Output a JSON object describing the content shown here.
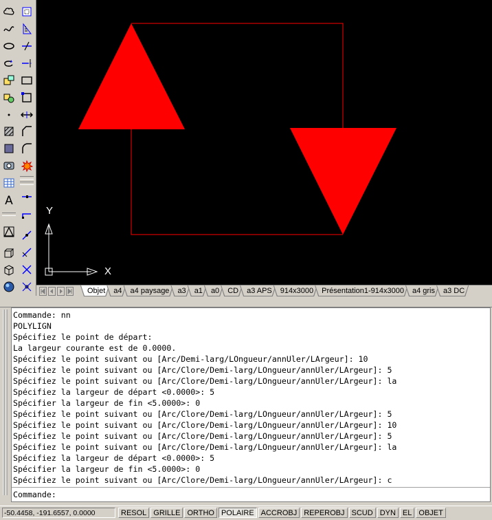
{
  "toolbars": {
    "draw": [
      "cloud-icon",
      "spline-icon",
      "ellipse-icon",
      "ellipse-arc-icon",
      "insert-block-icon",
      "make-block-icon",
      "point-icon",
      "hatch-icon",
      "gradient-icon",
      "region-icon",
      "table-icon",
      "multiline-text-icon",
      "add-selected-icon"
    ],
    "modify": [
      "copy-icon",
      "measure-icon",
      "trim-icon",
      "extend-icon",
      "rectangle-icon",
      "rectangle-icon",
      "stretch-icon",
      "chamfer-icon",
      "fillet-icon",
      "explode-icon",
      "break-at-point-icon",
      "break-icon",
      "join-icon",
      "polyline-edit-icon",
      "offset-icon",
      "scale-icon",
      "trim-icon",
      "erase-icon"
    ],
    "text_glyph": "A"
  },
  "canvas": {
    "drawing_color": "#ff0000",
    "background": "#000000",
    "ucs": {
      "x_label": "X",
      "y_label": "Y"
    }
  },
  "tabs": [
    "Objet",
    "a4",
    "a4 paysage",
    "a3",
    "a1",
    "a0",
    "CD",
    "a3 APS",
    "914x3000",
    "Présentation1-914x3000",
    "a4 gris",
    "a3 DC"
  ],
  "active_tab": "Objet",
  "command_history": [
    "Commande: nn",
    "POLYLIGN",
    "Spécifiez le point de départ:",
    "La largeur courante est de 0.0000.",
    "Spécifiez le point suivant ou [Arc/Demi-larg/LOngueur/annUler/LArgeur]: 10",
    "Spécifiez le point suivant ou [Arc/Clore/Demi-larg/LOngueur/annUler/LArgeur]: 5",
    "Spécifiez le point suivant ou [Arc/Clore/Demi-larg/LOngueur/annUler/LArgeur]: la",
    "Spécifiez la largeur de départ <0.0000>: 5",
    "Spécifier la largeur de fin <5.0000>: 0",
    "Spécifiez le point suivant ou [Arc/Clore/Demi-larg/LOngueur/annUler/LArgeur]: 5",
    "Spécifiez le point suivant ou [Arc/Clore/Demi-larg/LOngueur/annUler/LArgeur]: 10",
    "Spécifiez le point suivant ou [Arc/Clore/Demi-larg/LOngueur/annUler/LArgeur]: 5",
    "Spécifiez le point suivant ou [Arc/Clore/Demi-larg/LOngueur/annUler/LArgeur]: la",
    "Spécifiez la largeur de départ <0.0000>: 5",
    "Spécifier la largeur de fin <5.0000>: 0",
    "Spécifiez le point suivant ou [Arc/Clore/Demi-larg/LOngueur/annUler/LArgeur]: c"
  ],
  "command_prompt": "Commande:",
  "status": {
    "coordinates": "-50.4458, -191.6557, 0.0000",
    "modes": [
      {
        "label": "RESOL",
        "on": false
      },
      {
        "label": "GRILLE",
        "on": false
      },
      {
        "label": "ORTHO",
        "on": false
      },
      {
        "label": "POLAIRE",
        "on": true
      },
      {
        "label": "ACCROBJ",
        "on": false
      },
      {
        "label": "REPEROBJ",
        "on": false
      },
      {
        "label": "SCUD",
        "on": false
      },
      {
        "label": "DYN",
        "on": false
      },
      {
        "label": "EL",
        "on": false
      },
      {
        "label": "OBJET",
        "on": false
      }
    ]
  }
}
